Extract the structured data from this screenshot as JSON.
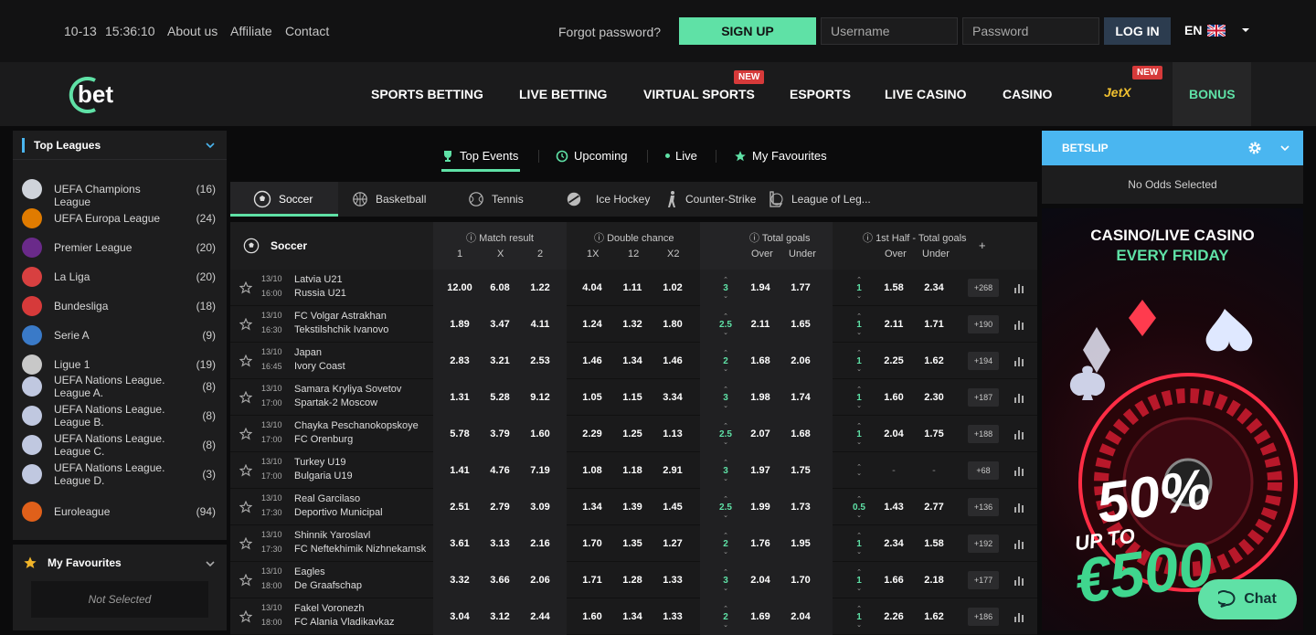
{
  "topbar": {
    "date": "10-13",
    "time": "15:36:10",
    "links": [
      "About us",
      "Affiliate",
      "Contact"
    ],
    "forgot": "Forgot password?",
    "signup": "SIGN UP",
    "username_placeholder": "Username",
    "password_placeholder": "Password",
    "login": "LOG IN",
    "lang": "EN"
  },
  "logo": {
    "text": "bet"
  },
  "nav": {
    "items": [
      "SPORTS BETTING",
      "LIVE BETTING",
      "VIRTUAL SPORTS",
      "ESPORTS",
      "LIVE CASINO",
      "CASINO",
      "JetX",
      "BONUS"
    ],
    "new_badge": "NEW"
  },
  "sidebar": {
    "title": "Top Leagues",
    "leagues": [
      {
        "name": "UEFA Champions League",
        "count": "(16)"
      },
      {
        "name": "UEFA Europa League",
        "count": "(24)"
      },
      {
        "name": "Premier League",
        "count": "(20)"
      },
      {
        "name": "La Liga",
        "count": "(20)"
      },
      {
        "name": "Bundesliga",
        "count": "(18)"
      },
      {
        "name": "Serie A",
        "count": "(9)"
      },
      {
        "name": "Ligue 1",
        "count": "(19)"
      },
      {
        "name": "UEFA Nations League. League A.",
        "count": "(8)"
      },
      {
        "name": "UEFA Nations League. League B.",
        "count": "(8)"
      },
      {
        "name": "UEFA Nations League. League C.",
        "count": "(8)"
      },
      {
        "name": "UEFA Nations League. League D.",
        "count": "(3)"
      },
      {
        "name": "Euroleague",
        "count": "(94)"
      }
    ],
    "fav_title": "My Favourites",
    "fav_empty": "Not Selected"
  },
  "tabs": [
    "Top Events",
    "Upcoming",
    "Live",
    "My Favourites"
  ],
  "sports": [
    "Soccer",
    "Basketball",
    "Tennis",
    "Ice Hockey",
    "Counter-Strike",
    "League of Leg..."
  ],
  "table": {
    "sport": "Soccer",
    "groups": [
      {
        "title": "Match result",
        "subs": [
          "1",
          "X",
          "2"
        ]
      },
      {
        "title": "Double chance",
        "subs": [
          "1X",
          "12",
          "X2"
        ]
      },
      {
        "title": "Total goals",
        "subs": [
          "Over",
          "Under"
        ]
      },
      {
        "title": "1st Half - Total goals",
        "subs": [
          "Over",
          "Under"
        ]
      }
    ],
    "plus": "+",
    "rows": [
      {
        "date": "13/10",
        "time": "16:00",
        "home": "Latvia U21",
        "away": "Russia U21",
        "mr": [
          "12.00",
          "6.08",
          "1.22"
        ],
        "dc": [
          "4.04",
          "1.11",
          "1.02"
        ],
        "tg_line": "3",
        "tg": [
          "1.94",
          "1.77"
        ],
        "h1_line": "1",
        "h1": [
          "1.58",
          "2.34"
        ],
        "more": "+268"
      },
      {
        "date": "13/10",
        "time": "16:30",
        "home": "FC Volgar Astrakhan",
        "away": "Tekstilshchik Ivanovo",
        "mr": [
          "1.89",
          "3.47",
          "4.11"
        ],
        "dc": [
          "1.24",
          "1.32",
          "1.80"
        ],
        "tg_line": "2.5",
        "tg": [
          "2.11",
          "1.65"
        ],
        "h1_line": "1",
        "h1": [
          "2.11",
          "1.71"
        ],
        "more": "+190"
      },
      {
        "date": "13/10",
        "time": "16:45",
        "home": "Japan",
        "away": "Ivory Coast",
        "mr": [
          "2.83",
          "3.21",
          "2.53"
        ],
        "dc": [
          "1.46",
          "1.34",
          "1.46"
        ],
        "tg_line": "2",
        "tg": [
          "1.68",
          "2.06"
        ],
        "h1_line": "1",
        "h1": [
          "2.25",
          "1.62"
        ],
        "more": "+194"
      },
      {
        "date": "13/10",
        "time": "17:00",
        "home": "Samara Kryliya Sovetov",
        "away": "Spartak-2 Moscow",
        "mr": [
          "1.31",
          "5.28",
          "9.12"
        ],
        "dc": [
          "1.05",
          "1.15",
          "3.34"
        ],
        "tg_line": "3",
        "tg": [
          "1.98",
          "1.74"
        ],
        "h1_line": "1",
        "h1": [
          "1.60",
          "2.30"
        ],
        "more": "+187"
      },
      {
        "date": "13/10",
        "time": "17:00",
        "home": "Chayka Peschanokopskoye",
        "away": "FC Orenburg",
        "mr": [
          "5.78",
          "3.79",
          "1.60"
        ],
        "dc": [
          "2.29",
          "1.25",
          "1.13"
        ],
        "tg_line": "2.5",
        "tg": [
          "2.07",
          "1.68"
        ],
        "h1_line": "1",
        "h1": [
          "2.04",
          "1.75"
        ],
        "more": "+188"
      },
      {
        "date": "13/10",
        "time": "17:00",
        "home": "Turkey U19",
        "away": "Bulgaria U19",
        "mr": [
          "1.41",
          "4.76",
          "7.19"
        ],
        "dc": [
          "1.08",
          "1.18",
          "2.91"
        ],
        "tg_line": "3",
        "tg": [
          "1.97",
          "1.75"
        ],
        "h1_line": "",
        "h1": [
          "-",
          "-"
        ],
        "more": "+68"
      },
      {
        "date": "13/10",
        "time": "17:30",
        "home": "Real Garcilaso",
        "away": "Deportivo Municipal",
        "mr": [
          "2.51",
          "2.79",
          "3.09"
        ],
        "dc": [
          "1.34",
          "1.39",
          "1.45"
        ],
        "tg_line": "2.5",
        "tg": [
          "1.99",
          "1.73"
        ],
        "h1_line": "0.5",
        "h1": [
          "1.43",
          "2.77"
        ],
        "more": "+136"
      },
      {
        "date": "13/10",
        "time": "17:30",
        "home": "Shinnik Yaroslavl",
        "away": "FC Neftekhimik Nizhnekamsk",
        "mr": [
          "3.61",
          "3.13",
          "2.16"
        ],
        "dc": [
          "1.70",
          "1.35",
          "1.27"
        ],
        "tg_line": "2",
        "tg": [
          "1.76",
          "1.95"
        ],
        "h1_line": "1",
        "h1": [
          "2.34",
          "1.58"
        ],
        "more": "+192"
      },
      {
        "date": "13/10",
        "time": "18:00",
        "home": "Eagles",
        "away": "De Graafschap",
        "mr": [
          "3.32",
          "3.66",
          "2.06"
        ],
        "dc": [
          "1.71",
          "1.28",
          "1.33"
        ],
        "tg_line": "3",
        "tg": [
          "2.04",
          "1.70"
        ],
        "h1_line": "1",
        "h1": [
          "1.66",
          "2.18"
        ],
        "more": "+177"
      },
      {
        "date": "13/10",
        "time": "18:00",
        "home": "Fakel Voronezh",
        "away": "FC Alania Vladikavkaz",
        "mr": [
          "3.04",
          "3.12",
          "2.44"
        ],
        "dc": [
          "1.60",
          "1.34",
          "1.33"
        ],
        "tg_line": "2",
        "tg": [
          "1.69",
          "2.04"
        ],
        "h1_line": "1",
        "h1": [
          "2.26",
          "1.62"
        ],
        "more": "+186"
      }
    ]
  },
  "betslip": {
    "title": "BETSLIP",
    "empty": "No Odds Selected"
  },
  "banner": {
    "line1": "CASINO/LIVE CASINO",
    "line2": "EVERY FRIDAY",
    "pct": "50%",
    "upto": "UP TO",
    "amount": "€500"
  },
  "chat": {
    "label": "Chat"
  },
  "colors": {
    "accent": "#5fe1a6",
    "betslip": "#4ab6f0",
    "badge": "#d63a3a"
  }
}
